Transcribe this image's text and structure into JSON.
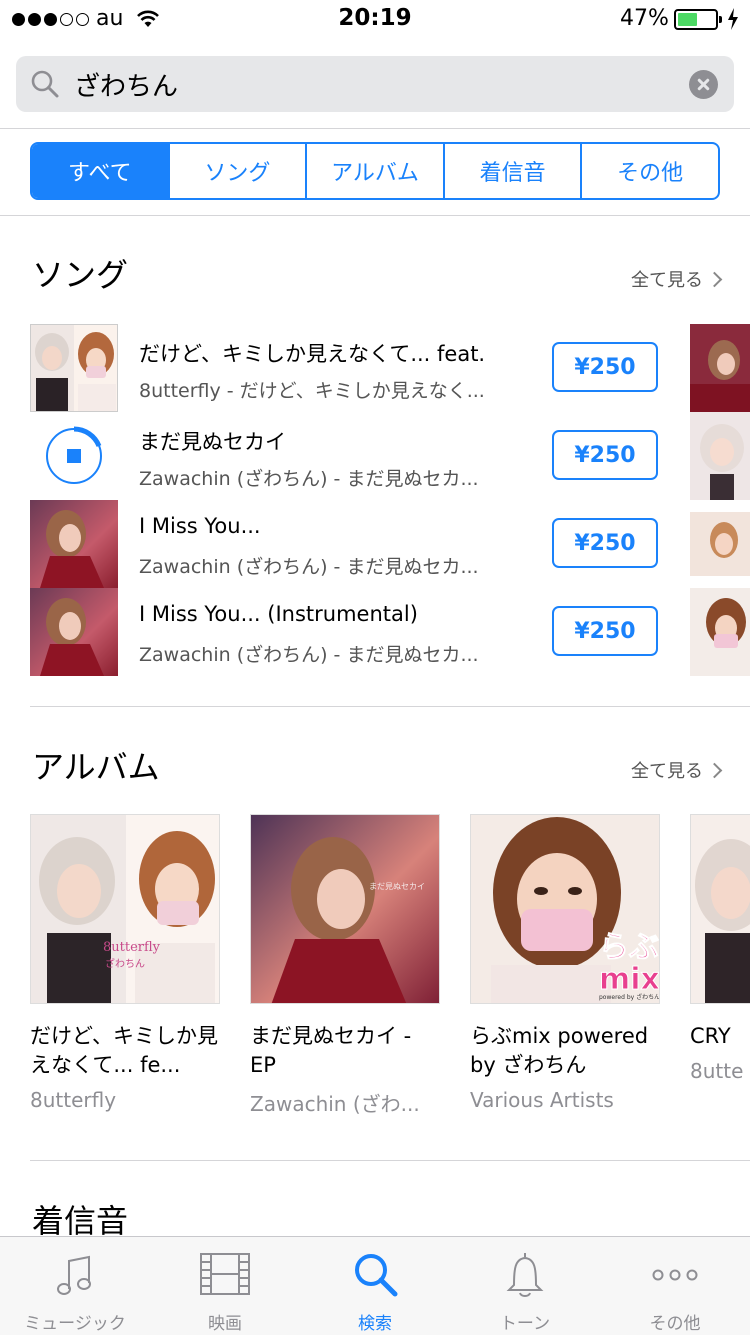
{
  "status_bar": {
    "carrier": "au",
    "time": "20:19",
    "battery_percent": "47%",
    "battery_level": 0.47,
    "signal_bars": 3
  },
  "search": {
    "query": "ざわちん",
    "search_icon": "magnifier-icon",
    "clear_icon": "clear-icon"
  },
  "segments": [
    {
      "label": "すべて",
      "selected": true
    },
    {
      "label": "ソング",
      "selected": false
    },
    {
      "label": "アルバム",
      "selected": false
    },
    {
      "label": "着信音",
      "selected": false
    },
    {
      "label": "その他",
      "selected": false
    }
  ],
  "songs_section": {
    "title": "ソング",
    "see_all": "全て見る",
    "items": [
      {
        "title": "だけど、キミしか見えなくて... feat.",
        "subtitle": "8utterfly - だけど、キミしか見えなく...",
        "price": "¥250"
      },
      {
        "title": "まだ見ぬセカイ",
        "subtitle": "Zawachin (ざわちん) - まだ見ぬセカ...",
        "price": "¥250"
      },
      {
        "title": "I Miss You...",
        "subtitle": "Zawachin (ざわちん) - まだ見ぬセカ...",
        "price": "¥250"
      },
      {
        "title": "I Miss You... (Instrumental)",
        "subtitle": "Zawachin (ざわちん) - まだ見ぬセカ...",
        "price": "¥250"
      }
    ]
  },
  "albums_section": {
    "title": "アルバム",
    "see_all": "全て見る",
    "items": [
      {
        "title": "だけど、キミしか見えなくて... fe...",
        "artist": "8utterfly"
      },
      {
        "title": "まだ見ぬセカイ - EP",
        "artist": "Zawachin (ざわ..."
      },
      {
        "title": "らぶmix powered by ざわちん",
        "artist": "Various Artists"
      },
      {
        "title": "CRY",
        "artist": "8utte"
      }
    ],
    "cover_texts": {
      "album1_logo": "8utterfly",
      "album1_sub": "ざわちん",
      "album2_caption": "まだ見ぬセカイ",
      "album3_logo_line1": "らぶ",
      "album3_logo_line2": "mix",
      "album3_powered": "powered by ざわちん"
    }
  },
  "ringtones_section": {
    "title": "着信音"
  },
  "tab_bar": [
    {
      "label": "ミュージック",
      "icon": "music-note-icon",
      "active": false
    },
    {
      "label": "映画",
      "icon": "film-icon",
      "active": false
    },
    {
      "label": "検索",
      "icon": "search-icon",
      "active": true
    },
    {
      "label": "トーン",
      "icon": "bell-icon",
      "active": false
    },
    {
      "label": "その他",
      "icon": "more-icon",
      "active": false
    }
  ],
  "colors": {
    "accent": "#1a82fb",
    "battery": "#4cd964"
  }
}
